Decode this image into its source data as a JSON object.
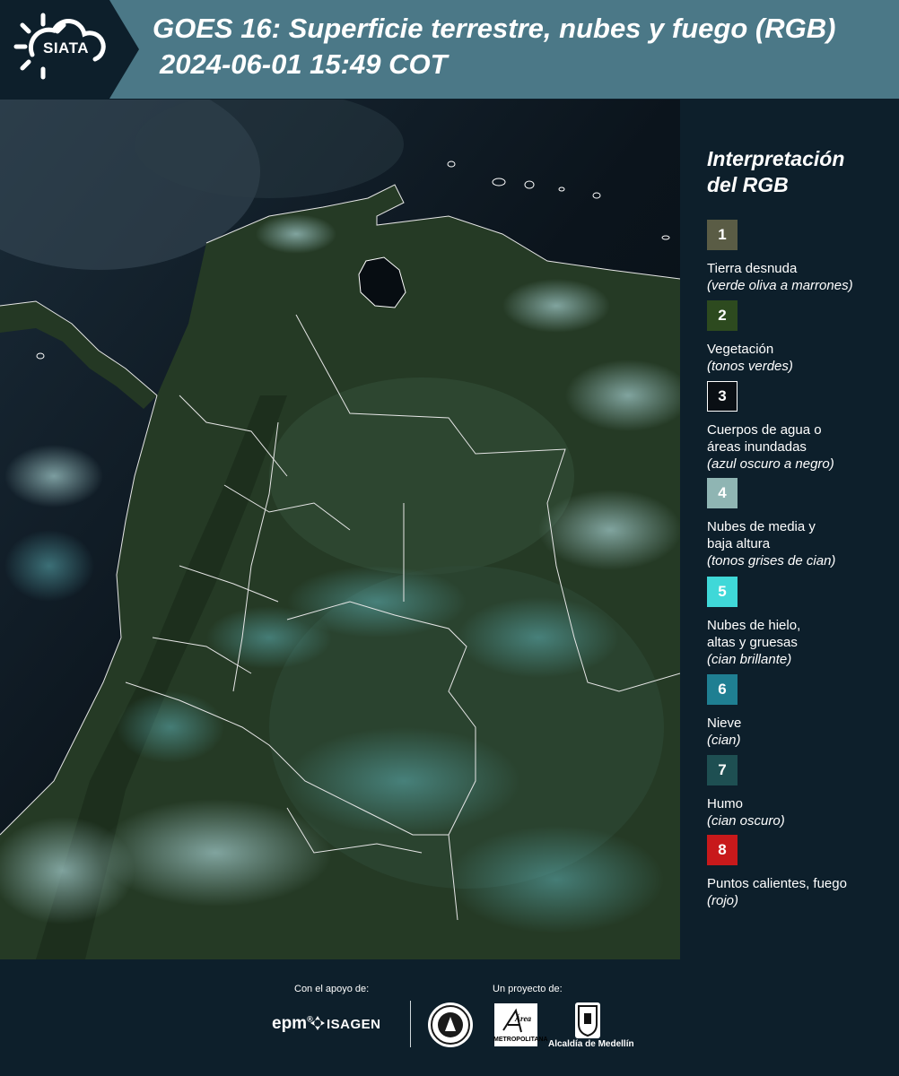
{
  "header": {
    "logo_text": "SIATA",
    "title": "GOES 16: Superficie terrestre, nubes y fuego (RGB)",
    "subtitle": "2024-06-01 15:49 COT"
  },
  "legend": {
    "title_line1": "Interpretación",
    "title_line2": "del RGB",
    "items": [
      {
        "number": "1",
        "color": "#5a5c45",
        "label": "Tierra desnuda",
        "note": "(verde oliva a marrones)"
      },
      {
        "number": "2",
        "color": "#2d4a1f",
        "label": "Vegetación",
        "note": "(tonos verdes)"
      },
      {
        "number": "3",
        "color": "#0a0f14",
        "label": "Cuerpos de agua o",
        "label2": "áreas inundadas",
        "note": "(azul oscuro a negro)"
      },
      {
        "number": "4",
        "color": "#8fb5b3",
        "label": "Nubes de media y",
        "label2": "baja altura",
        "note": "(tonos grises de cian)"
      },
      {
        "number": "5",
        "color": "#3fd8d8",
        "label": "Nubes de hielo,",
        "label2": "altas y gruesas",
        "note": "(cian brillante)"
      },
      {
        "number": "6",
        "color": "#1f7f92",
        "label": "Nieve",
        "note": "(cian)"
      },
      {
        "number": "7",
        "color": "#1e4f52",
        "label": "Humo",
        "note": "(cian oscuro)"
      },
      {
        "number": "8",
        "color": "#c8191b",
        "label": "Puntos calientes, fuego",
        "note": "(rojo)"
      }
    ]
  },
  "footer": {
    "support_label": "Con el apoyo de:",
    "project_label": "Un proyecto de:",
    "sponsor_epm": "epm",
    "sponsor_isagen": "ISAGEN",
    "area_logo_text": "Área",
    "area_logo_subtext": "METROPOLITANA",
    "alcaldia_label": "Alcaldía de Medellín"
  }
}
